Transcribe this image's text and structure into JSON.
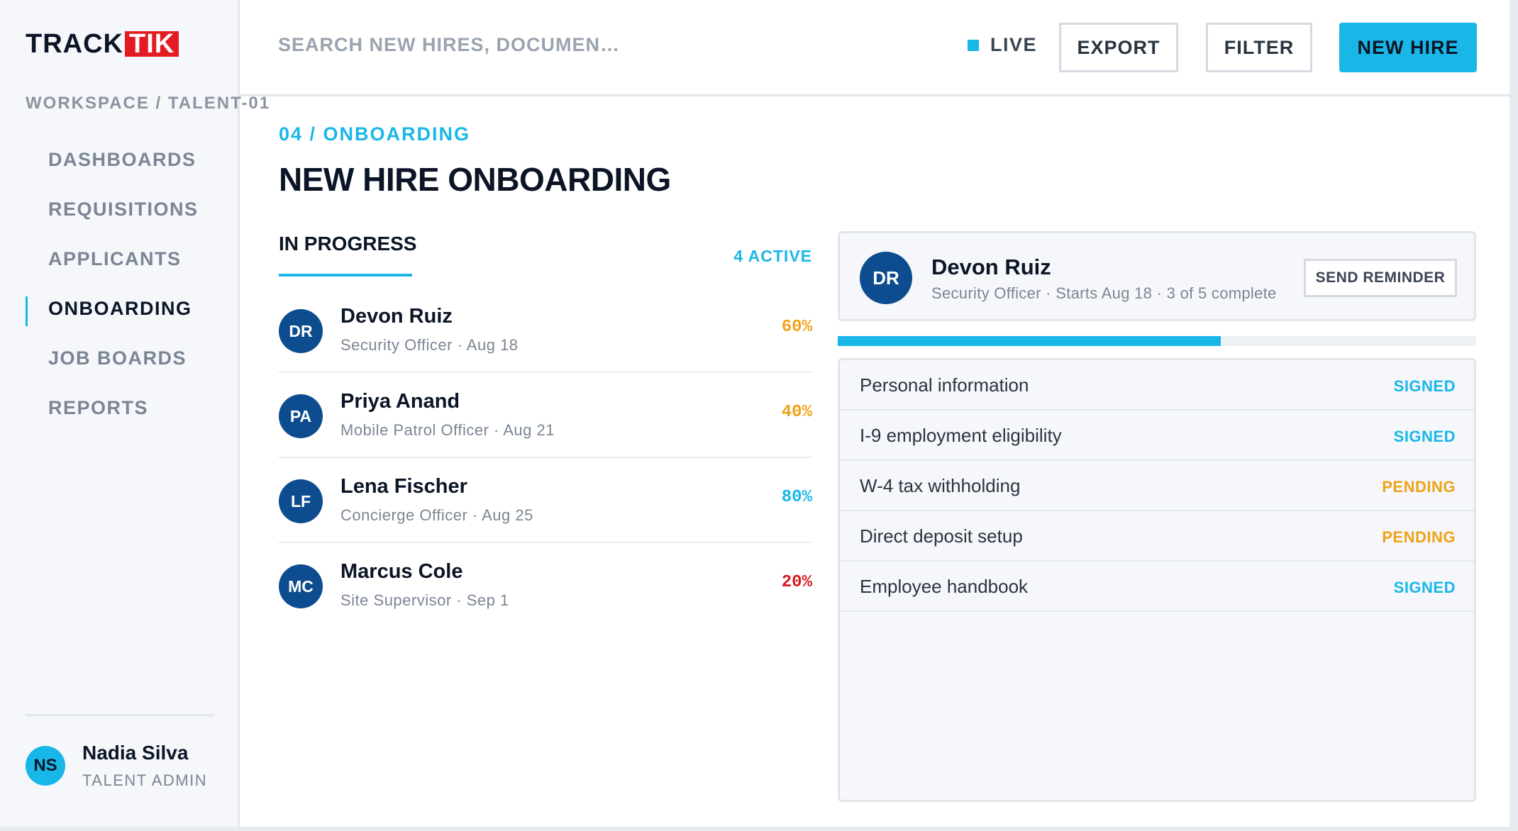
{
  "brand": {
    "track": "TRACK",
    "tik": "TIK"
  },
  "sidebar": {
    "workspace": "WORKSPACE / TALENT-01",
    "items": [
      {
        "label": "DASHBOARDS"
      },
      {
        "label": "REQUISITIONS"
      },
      {
        "label": "APPLICANTS"
      },
      {
        "label": "ONBOARDING",
        "active": true
      },
      {
        "label": "JOB BOARDS"
      },
      {
        "label": "REPORTS"
      }
    ],
    "user": {
      "initials": "NS",
      "name": "Nadia Silva",
      "role": "TALENT ADMIN"
    }
  },
  "topbar": {
    "search_placeholder": "SEARCH NEW HIRES, DOCUMEN…",
    "live": "LIVE",
    "export": "EXPORT",
    "filter": "FILTER",
    "new_hire": "NEW HIRE"
  },
  "main": {
    "crumb": "04 / ONBOARDING",
    "title": "NEW HIRE ONBOARDING",
    "tab": "IN PROGRESS",
    "active_count": "4 ACTIVE",
    "hires": [
      {
        "initials": "DR",
        "name": "Devon Ruiz",
        "sub": "Security Officer · Aug 18",
        "pct": "60%",
        "pct_color": "#f0a219"
      },
      {
        "initials": "PA",
        "name": "Priya Anand",
        "sub": "Mobile Patrol Officer · Aug 21",
        "pct": "40%",
        "pct_color": "#f0a219"
      },
      {
        "initials": "LF",
        "name": "Lena Fischer",
        "sub": "Concierge Officer · Aug 25",
        "pct": "80%",
        "pct_color": "#19b7e8"
      },
      {
        "initials": "MC",
        "name": "Marcus Cole",
        "sub": "Site Supervisor · Sep 1",
        "pct": "20%",
        "pct_color": "#d61b24"
      }
    ]
  },
  "detail": {
    "initials": "DR",
    "name": "Devon Ruiz",
    "sub": "Security Officer · Starts Aug 18 · 3 of 5 complete",
    "send_reminder": "SEND REMINDER",
    "progress": 0.6,
    "checklist": [
      {
        "label": "Personal information",
        "status": "SIGNED",
        "color": "#19b7e8"
      },
      {
        "label": "I-9 employment eligibility",
        "status": "SIGNED",
        "color": "#19b7e8"
      },
      {
        "label": "W-4 tax withholding",
        "status": "PENDING",
        "color": "#f0a219"
      },
      {
        "label": "Direct deposit setup",
        "status": "PENDING",
        "color": "#f0a219"
      },
      {
        "label": "Employee handbook",
        "status": "SIGNED",
        "color": "#19b7e8"
      }
    ]
  },
  "colors": {
    "accent": "#19b7e8",
    "brand_red": "#e31b23",
    "avatar": "#0d4c8e"
  }
}
